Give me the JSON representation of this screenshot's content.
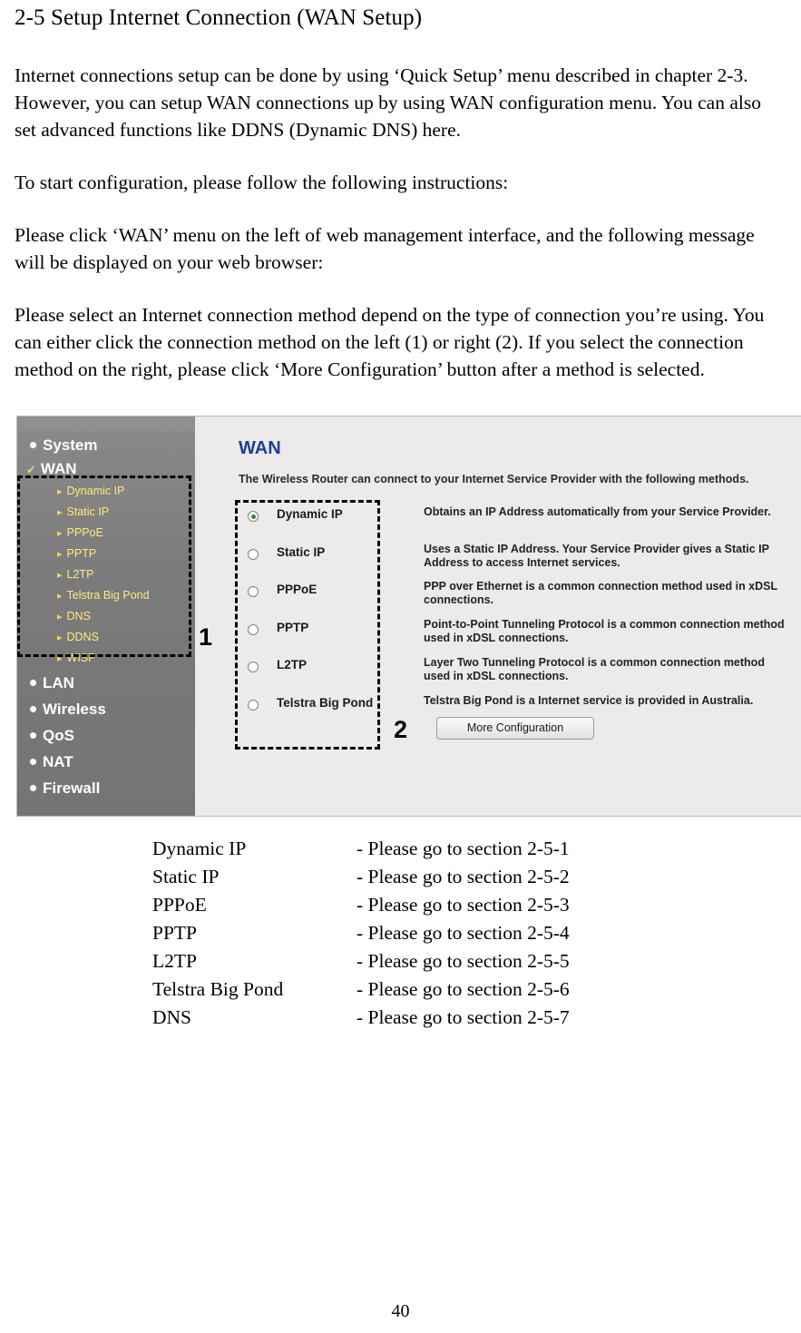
{
  "document": {
    "title": "2-5 Setup Internet Connection (WAN Setup)",
    "paragraphs": [
      "Internet connections setup can be done by using ‘Quick Setup’ menu described in chapter 2-3. However, you can setup WAN connections up by using WAN configuration menu. You can also set advanced functions like DDNS (Dynamic DNS) here.",
      "To start configuration, please follow the following instructions:",
      "Please click ‘WAN’ menu on the left of web management interface, and the following message will be displayed on your web browser:",
      "Please select an Internet connection method depend on the type of connection you’re using. You can either click the connection method on the left (1) or right (2). If you select the connection method on the right, please click ‘More Configuration’ button after a method is selected."
    ],
    "page_number": "40"
  },
  "screenshot": {
    "sidebar": {
      "items": [
        {
          "label": "System",
          "type": "main"
        },
        {
          "label": "WAN",
          "type": "main-checked"
        },
        {
          "label": "Dynamic IP",
          "type": "sub"
        },
        {
          "label": "Static IP",
          "type": "sub"
        },
        {
          "label": "PPPoE",
          "type": "sub"
        },
        {
          "label": "PPTP",
          "type": "sub"
        },
        {
          "label": "L2TP",
          "type": "sub"
        },
        {
          "label": "Telstra Big Pond",
          "type": "sub"
        },
        {
          "label": "DNS",
          "type": "sub"
        },
        {
          "label": "DDNS",
          "type": "sub"
        },
        {
          "label": "WISP",
          "type": "sub"
        },
        {
          "label": "LAN",
          "type": "main"
        },
        {
          "label": "Wireless",
          "type": "main"
        },
        {
          "label": "QoS",
          "type": "main"
        },
        {
          "label": "NAT",
          "type": "main"
        },
        {
          "label": "Firewall",
          "type": "main"
        }
      ]
    },
    "panel": {
      "title": "WAN",
      "description": "The Wireless Router can connect to your Internet Service Provider with the following methods.",
      "options": [
        {
          "label": "Dynamic IP",
          "selected": true,
          "description": "Obtains an IP Address automatically from your Service Provider."
        },
        {
          "label": "Static IP",
          "selected": false,
          "description": "Uses a Static IP Address. Your Service Provider gives a Static IP Address to access Internet services."
        },
        {
          "label": "PPPoE",
          "selected": false,
          "description": "PPP over Ethernet is a common connection method used in xDSL connections."
        },
        {
          "label": "PPTP",
          "selected": false,
          "description": "Point-to-Point Tunneling Protocol is a common connection method used in xDSL connections."
        },
        {
          "label": "L2TP",
          "selected": false,
          "description": "Layer Two Tunneling Protocol is a common connection method used in xDSL connections."
        },
        {
          "label": "Telstra Big Pond",
          "selected": false,
          "description": "Telstra Big Pond is a Internet service is provided in Australia."
        }
      ],
      "more_config_button": "More Configuration",
      "annotation_left": "1",
      "annotation_right": "2"
    }
  },
  "section_list": [
    {
      "name": "Dynamic IP",
      "ref": "- Please go to section 2-5-1"
    },
    {
      "name": "Static IP",
      "ref": "- Please go to section 2-5-2"
    },
    {
      "name": "PPPoE",
      "ref": "- Please go to section 2-5-3"
    },
    {
      "name": "PPTP",
      "ref": "- Please go to section 2-5-4"
    },
    {
      "name": "L2TP",
      "ref": "- Please go to section 2-5-5"
    },
    {
      "name": "Telstra Big Pond",
      "ref": "- Please go to section 2-5-6"
    },
    {
      "name": "DNS",
      "ref": "- Please go to section 2-5-7"
    }
  ]
}
